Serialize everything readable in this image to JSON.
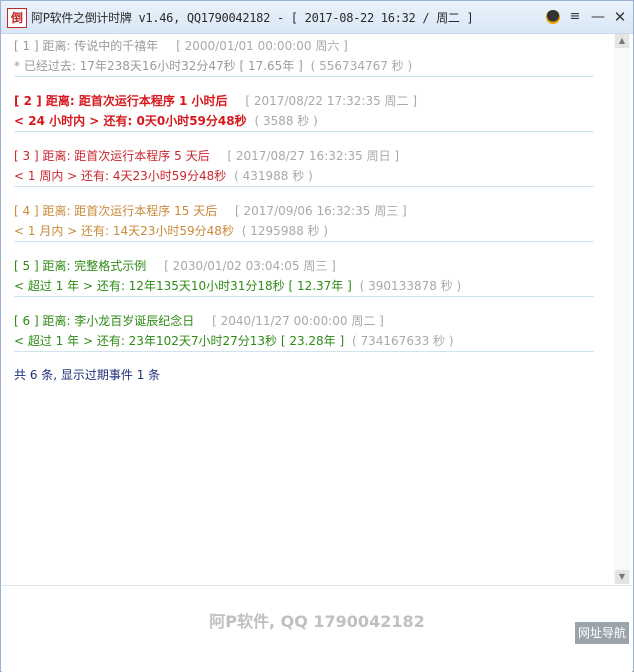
{
  "window": {
    "icon_char": "倒",
    "title": "阿P软件之倒计时牌 v1.46, QQ1790042182 - [ 2017-08-22 16:32 / 周二 ]",
    "menu_glyph": "≡",
    "min_glyph": "—",
    "close_glyph": "✕"
  },
  "entries": [
    {
      "line1": {
        "head": "[ 1 ] 距离: 传说中的千禧年",
        "meta": "[ 2000/01/01 00:00:00 周六 ]"
      },
      "line2": {
        "head": "* 已经过去: 17年238天16小时32分47秒 [ 17.65年 ]",
        "meta": "( 556734767 秒 )"
      }
    },
    {
      "line1": {
        "head": "[ 2 ] 距离: 距首次运行本程序  1 小时后",
        "meta": "[ 2017/08/22 17:32:35 周二 ]"
      },
      "line2": {
        "head": "< 24 小时内 > 还有: 0天0小时59分48秒",
        "meta": "( 3588 秒 )"
      }
    },
    {
      "line1": {
        "head": "[ 3 ] 距离: 距首次运行本程序  5 天后",
        "meta": "[ 2017/08/27 16:32:35 周日 ]"
      },
      "line2": {
        "head": "< 1 周内 > 还有: 4天23小时59分48秒",
        "meta": "( 431988 秒 )"
      }
    },
    {
      "line1": {
        "head": "[ 4 ] 距离: 距首次运行本程序  15 天后",
        "meta": "[ 2017/09/06 16:32:35 周三 ]"
      },
      "line2": {
        "head": "< 1 月内 > 还有: 14天23小时59分48秒",
        "meta": "( 1295988 秒 )"
      }
    },
    {
      "line1": {
        "head": "[ 5 ] 距离: 完整格式示例",
        "meta": "[ 2030/01/02 03:04:05 周三 ]"
      },
      "line2": {
        "head": "< 超过  1 年 > 还有: 12年135天10小时31分18秒 [ 12.37年 ]",
        "meta": "( 390133878 秒 )"
      }
    },
    {
      "line1": {
        "head": "[ 6 ] 距离: 李小龙百岁诞辰纪念日",
        "meta": "[ 2040/11/27 00:00:00 周二 ]"
      },
      "line2": {
        "head": "< 超过  1 年 > 还有: 23年102天7小时27分13秒 [ 23.28年 ]",
        "meta": "( 734167633 秒 )"
      }
    }
  ],
  "summary": "共  6 条, 显示过期事件  1 条",
  "footer": {
    "brand": "阿P软件, QQ 1790042182",
    "nav_button": "网址导航"
  },
  "scrollbar": {
    "up": "▲",
    "down": "▼"
  },
  "colors": {
    "entry1": "#9a9a9a",
    "entry2": "#d7191e",
    "entry3": "#c8282e",
    "entry4": "#c98a3a",
    "entry5": "#2e8b16",
    "entry6": "#2e8b16"
  }
}
